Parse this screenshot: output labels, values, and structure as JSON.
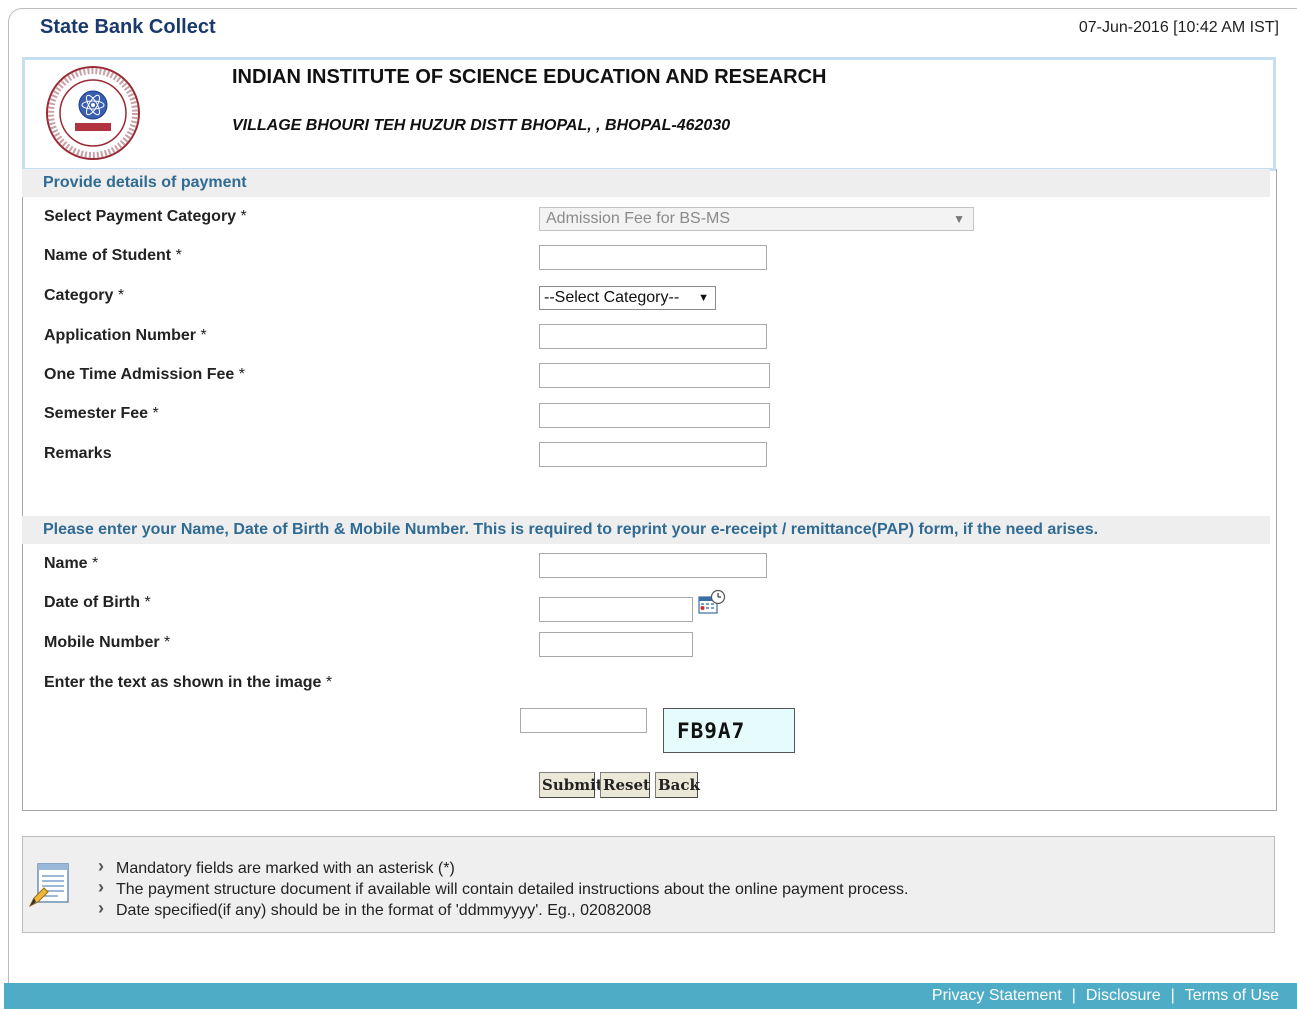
{
  "header": {
    "app_title": "State Bank Collect",
    "datetime": "07-Jun-2016 [10:42 AM IST]"
  },
  "institute": {
    "name": "INDIAN INSTITUTE OF SCIENCE EDUCATION AND RESEARCH",
    "address": "VILLAGE BHOURI TEH HUZUR DISTT BHOPAL, , BHOPAL-462030"
  },
  "payment_section": {
    "title": "Provide details of payment",
    "payment_category_label": "Select Payment Category",
    "payment_category_value": "Admission Fee for BS-MS",
    "student_name_label": "Name of Student",
    "category_label": "Category",
    "category_value": "--Select Category--",
    "application_number_label": "Application Number",
    "one_time_fee_label": "One Time Admission Fee",
    "semester_fee_label": "Semester Fee",
    "remarks_label": "Remarks"
  },
  "reprint_section": {
    "title": "Please enter your Name, Date of Birth & Mobile Number. This is required to reprint your e-receipt / remittance(PAP) form, if the need arises.",
    "name_label": "Name",
    "dob_label": "Date of Birth",
    "mobile_label": "Mobile Number",
    "captcha_label": "Enter the text as shown in the image",
    "captcha_text": "FB9A7"
  },
  "required_marker": "*",
  "buttons": {
    "submit": "Submit",
    "reset": "Reset",
    "back": "Back"
  },
  "notes": [
    "Mandatory fields are marked with an asterisk (*)",
    "The payment structure document if available will contain detailed instructions about the online payment process.",
    "Date specified(if any) should be in the format of 'ddmmyyyy'. Eg., 02082008"
  ],
  "footer": {
    "privacy": "Privacy Statement",
    "disclosure": "Disclosure",
    "terms": "Terms of Use",
    "separator": "|"
  },
  "colors": {
    "title_blue": "#1a3a6e",
    "section_text": "#2f6b93",
    "footer_bg": "#4eacc6",
    "captcha_bg": "#e6fbfb"
  }
}
